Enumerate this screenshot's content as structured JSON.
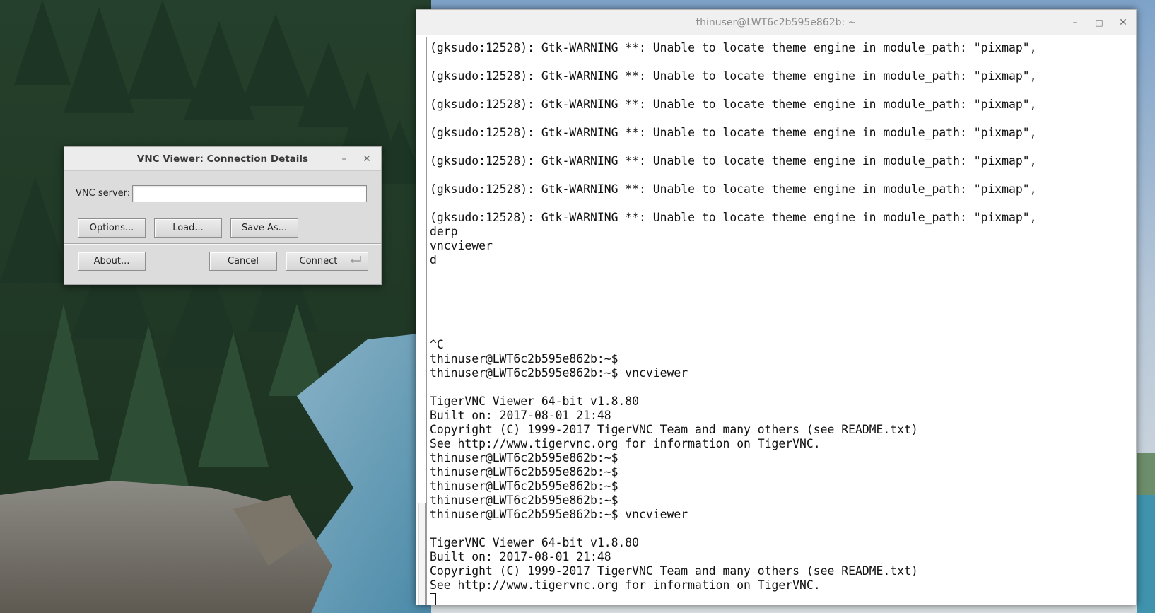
{
  "desktop": {
    "wallpaper": "forest-river-wallpaper"
  },
  "terminal": {
    "title": "thinuser@LWT6c2b595e862b: ~",
    "controls": {
      "minimize": "–",
      "maximize": "□",
      "close": "✕"
    },
    "lines": [
      "(gksudo:12528): Gtk-WARNING **: Unable to locate theme engine in module_path: \"pixmap\",",
      "",
      "(gksudo:12528): Gtk-WARNING **: Unable to locate theme engine in module_path: \"pixmap\",",
      "",
      "(gksudo:12528): Gtk-WARNING **: Unable to locate theme engine in module_path: \"pixmap\",",
      "",
      "(gksudo:12528): Gtk-WARNING **: Unable to locate theme engine in module_path: \"pixmap\",",
      "",
      "(gksudo:12528): Gtk-WARNING **: Unable to locate theme engine in module_path: \"pixmap\",",
      "",
      "(gksudo:12528): Gtk-WARNING **: Unable to locate theme engine in module_path: \"pixmap\",",
      "",
      "(gksudo:12528): Gtk-WARNING **: Unable to locate theme engine in module_path: \"pixmap\",",
      "derp",
      "vncviewer",
      "d",
      "",
      "",
      "",
      "",
      "",
      "^C",
      "thinuser@LWT6c2b595e862b:~$",
      "thinuser@LWT6c2b595e862b:~$ vncviewer",
      "",
      "TigerVNC Viewer 64-bit v1.8.80",
      "Built on: 2017-08-01 21:48",
      "Copyright (C) 1999-2017 TigerVNC Team and many others (see README.txt)",
      "See http://www.tigervnc.org for information on TigerVNC.",
      "thinuser@LWT6c2b595e862b:~$",
      "thinuser@LWT6c2b595e862b:~$",
      "thinuser@LWT6c2b595e862b:~$",
      "thinuser@LWT6c2b595e862b:~$",
      "thinuser@LWT6c2b595e862b:~$ vncviewer",
      "",
      "TigerVNC Viewer 64-bit v1.8.80",
      "Built on: 2017-08-01 21:48",
      "Copyright (C) 1999-2017 TigerVNC Team and many others (see README.txt)",
      "See http://www.tigervnc.org for information on TigerVNC.",
      ""
    ]
  },
  "vnc_dialog": {
    "title": "VNC Viewer: Connection Details",
    "controls": {
      "minimize": "–",
      "close": "✕"
    },
    "server_label": "VNC server:",
    "server_value": "",
    "buttons": {
      "options": "Options...",
      "load": "Load...",
      "save_as": "Save As...",
      "about": "About...",
      "cancel": "Cancel",
      "connect": "Connect"
    }
  },
  "colors": {
    "terminal_bg": "#ffffff",
    "terminal_text": "#111111",
    "titlebar_text": "#8c8c8c",
    "dialog_bg": "#dcdcdc"
  }
}
